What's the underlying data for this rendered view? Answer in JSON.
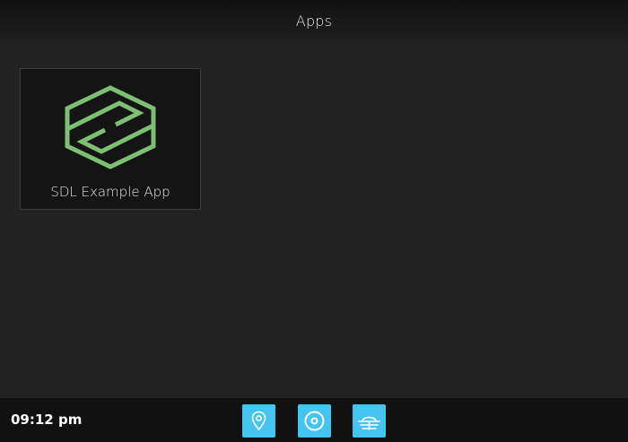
{
  "header": {
    "title": "Apps"
  },
  "apps": [
    {
      "label": "SDL Example App",
      "icon": "sdl-logo-icon",
      "icon_color": "#7dbf73"
    }
  ],
  "bottom_bar": {
    "time": "09:12 pm",
    "buttons": [
      {
        "icon": "map-pin-icon",
        "name": "navigation"
      },
      {
        "icon": "disc-icon",
        "name": "media"
      },
      {
        "icon": "climate-icon",
        "name": "climate"
      }
    ],
    "button_color": "#45c4f0"
  },
  "colors": {
    "background": "#222222",
    "bar": "#111111",
    "tile": "#141414"
  }
}
